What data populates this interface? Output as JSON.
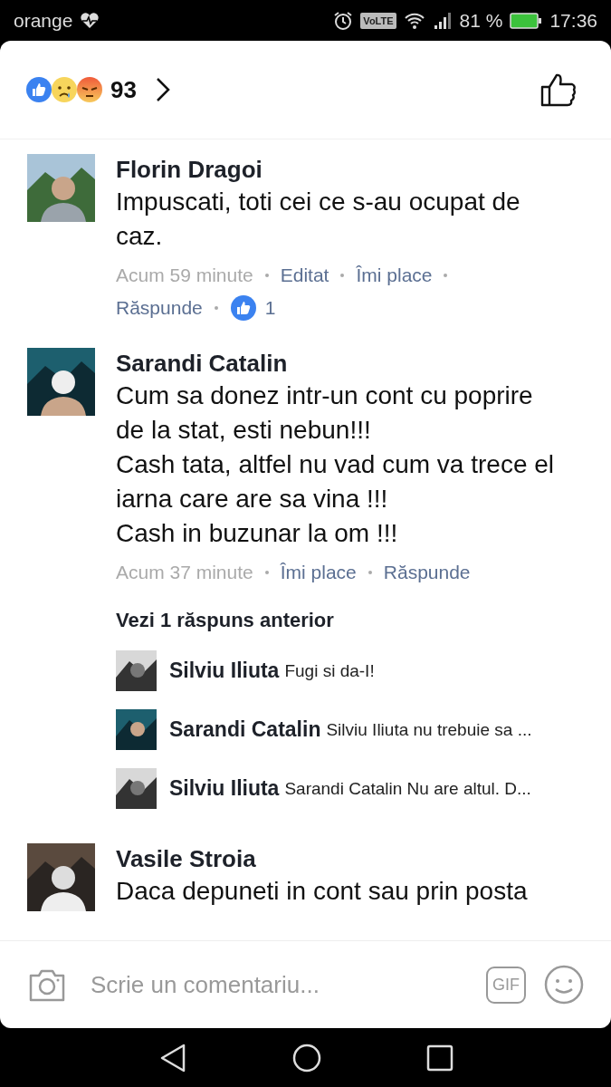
{
  "status_bar": {
    "carrier": "orange",
    "volte": "VoLTE",
    "battery": "81 %",
    "time": "17:36"
  },
  "reactions": {
    "count": "93"
  },
  "comments": [
    {
      "name": "Florin Dragoi",
      "lines": [
        "Impuscati, toti cei ce s-au ocupat de caz."
      ],
      "time": "Acum 59 minute",
      "actions": [
        "Editat",
        "Îmi place",
        "Răspunde"
      ],
      "likes": "1"
    },
    {
      "name": "Sarandi Catalin",
      "lines": [
        "Cum sa donez intr-un cont cu poprire de la stat, esti nebun!!!",
        "Cash tata, altfel nu vad cum va trece el iarna care are sa vina !!!",
        "Cash in buzunar la om !!!"
      ],
      "time": "Acum 37 minute",
      "actions": [
        "Îmi place",
        "Răspunde"
      ],
      "replies": {
        "more": "Vezi 1 răspuns anterior",
        "items": [
          {
            "name": "Silviu Iliuta",
            "text": "Fugi si da-I!"
          },
          {
            "name": "Sarandi Catalin",
            "text": "Silviu Iliuta nu trebuie sa ..."
          },
          {
            "name": "Silviu Iliuta",
            "text": "Sarandi Catalin Nu are altul. D..."
          }
        ]
      }
    },
    {
      "name": "Vasile Stroia",
      "lines": [
        "Daca depuneti in cont sau prin posta"
      ]
    }
  ],
  "composer": {
    "placeholder": "Scrie un comentariu...",
    "gif": "GIF"
  }
}
